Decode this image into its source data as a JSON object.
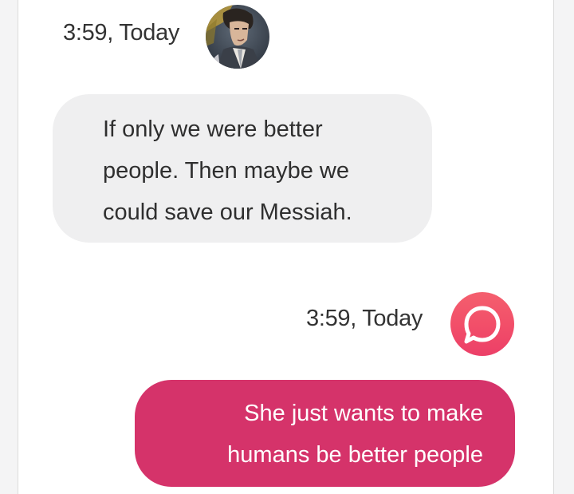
{
  "messages": [
    {
      "sender": "bot",
      "timestamp": "3:59, Today",
      "avatar_icon": "character-portrait-avatar",
      "lines": [
        "If only we were better",
        "people. Then maybe we",
        "could save our Messiah."
      ],
      "bubble_color": "#efeff0"
    },
    {
      "sender": "user",
      "timestamp": "3:59, Today",
      "avatar_icon": "speech-bubble-logo-icon",
      "lines": [
        "She just wants to make",
        "humans be better people"
      ],
      "bubble_color": "#d5336a"
    }
  ],
  "colors": {
    "accent": "#d5336a",
    "logo_gradient_top": "#f45f6e",
    "logo_gradient_bottom": "#ec3f68",
    "incoming_bubble": "#efeff0",
    "background": "#ffffff"
  }
}
